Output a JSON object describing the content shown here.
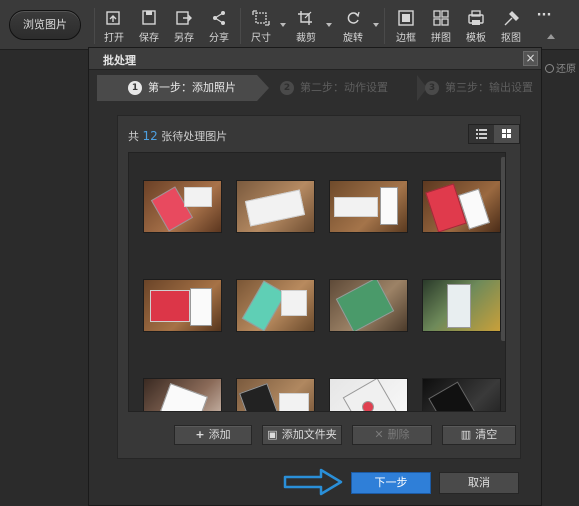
{
  "toolbar": {
    "browse_label": "浏览图片",
    "tools": [
      {
        "label": "打开",
        "icon": "open-icon"
      },
      {
        "label": "保存",
        "icon": "save-icon"
      },
      {
        "label": "另存",
        "icon": "save-as-icon"
      },
      {
        "label": "分享",
        "icon": "share-icon"
      },
      {
        "label": "尺寸",
        "icon": "resize-icon"
      },
      {
        "label": "裁剪",
        "icon": "crop-icon"
      },
      {
        "label": "旋转",
        "icon": "rotate-icon"
      },
      {
        "label": "边框",
        "icon": "border-icon"
      },
      {
        "label": "拼图",
        "icon": "collage-icon"
      },
      {
        "label": "模板",
        "icon": "template-icon"
      },
      {
        "label": "抠图",
        "icon": "cutout-icon"
      }
    ],
    "more": "···"
  },
  "dialog": {
    "title": "批处理",
    "close": "×",
    "steps": [
      {
        "num": "1",
        "label": "第一步：添加照片",
        "active": true
      },
      {
        "num": "2",
        "label": "第二步：动作设置",
        "active": false
      },
      {
        "num": "3",
        "label": "第三步：输出设置",
        "active": false
      }
    ],
    "count_prefix": "共",
    "count_value": "12",
    "count_suffix": "张待处理图片",
    "buttons": {
      "add": "添加",
      "add_folder": "添加文件夹",
      "delete": "删除",
      "clear": "清空"
    },
    "next": "下一步",
    "cancel": "取消"
  },
  "right_restore": "还原",
  "thumbnails": [
    "phone-photo-1",
    "phone-photo-2",
    "phone-photo-3",
    "phone-photo-4",
    "phone-photo-5",
    "phone-photo-6",
    "phone-photo-7",
    "phone-photo-8",
    "phone-photo-9",
    "phone-photo-10",
    "phone-photo-11",
    "phone-photo-12"
  ],
  "colors": {
    "accent": "#2f7fd8",
    "count": "#4ea0e0",
    "hint_arrow": "#2a8fd8"
  }
}
